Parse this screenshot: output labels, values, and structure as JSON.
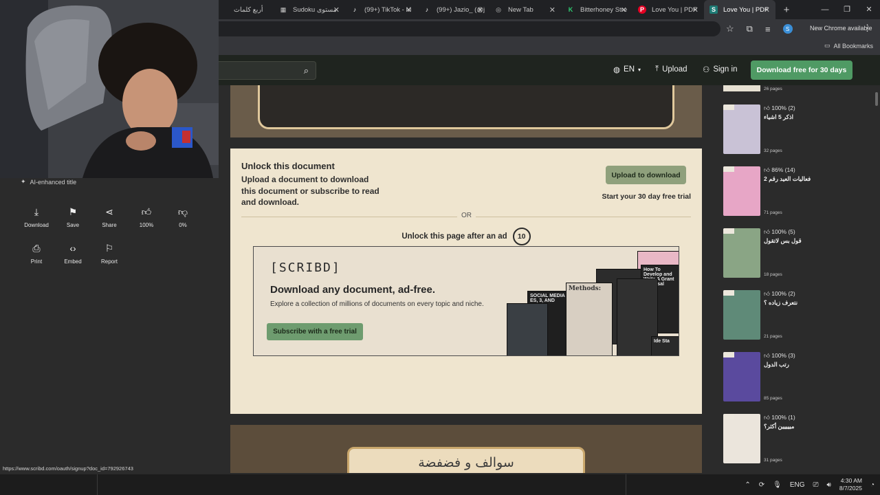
{
  "browser": {
    "tabs": [
      {
        "title": "أربع كلمات",
        "icon": "",
        "color": "#202124"
      },
      {
        "title": "Sudoku مستوى",
        "icon": "▦",
        "color": "#c8c8c8"
      },
      {
        "title": "(99+) TikTok - M",
        "icon": "♪",
        "color": "#ffffff"
      },
      {
        "title": "(99+) Jazio_ (@j",
        "icon": "♪",
        "color": "#ffffff"
      },
      {
        "title": "New Tab",
        "icon": "◎",
        "color": "#c8c8c8"
      },
      {
        "title": "Bitterhoney Stre",
        "icon": "K",
        "color": "#2ecc71"
      },
      {
        "title": "Love You | PDF",
        "icon": "P",
        "color": "#e60023"
      },
      {
        "title": "Love You | PDF",
        "icon": "S",
        "color": "#1e7b75"
      }
    ],
    "new_chrome_label": "New Chrome available",
    "profile_initial": "S",
    "all_bookmarks_label": "All Bookmarks"
  },
  "header": {
    "language": "EN",
    "upload_label": "Upload",
    "signin_label": "Sign in",
    "download_free_label": "Download free for 30 days"
  },
  "left_panel": {
    "ai_title": "AI-enhanced title",
    "actions": [
      {
        "label": "Download",
        "icon": "download-icon"
      },
      {
        "label": "Save",
        "icon": "bookmark-icon"
      },
      {
        "label": "Share",
        "icon": "share-icon"
      },
      {
        "label": "100%",
        "icon": "thumbs-up-icon"
      },
      {
        "label": "0%",
        "icon": "thumbs-down-icon"
      },
      {
        "label": "Print",
        "icon": "print-icon"
      },
      {
        "label": "Embed",
        "icon": "embed-icon"
      },
      {
        "label": "Report",
        "icon": "flag-icon"
      }
    ]
  },
  "unlock": {
    "title": "Unlock this document",
    "description": "Upload a document to download this document or subscribe to read and download.",
    "upload_button": "Upload to download",
    "trial_text": "Start your 30 day free trial",
    "or": "OR",
    "ad_text": "Unlock this page after an ad",
    "countdown": "10"
  },
  "ad": {
    "logo": "[SCRIBD]",
    "headline": "Download any document, ad-free.",
    "sub": "Explore a collection of millions of documents on every topic and niche.",
    "button": "Subscribe with a free trial",
    "book_titles": [
      "How To Develop and Write A Grant Proposal",
      "SOCIAL MEDIA ES, 3, AND",
      "Methods:",
      "Ide Sta"
    ]
  },
  "next_page_title": "سوالف و فضفضة",
  "sidebar": {
    "top_pages": "26 pages",
    "items": [
      {
        "stat": "100% (2)",
        "name": "اذكر 5 اشياء",
        "pages": "32 pages",
        "thumb": "#c9c2d6"
      },
      {
        "stat": "86% (14)",
        "name": "فعاليات العيد رقم 2",
        "pages": "71 pages",
        "thumb": "#e7a6c6"
      },
      {
        "stat": "100% (5)",
        "name": "قول بس لاتقول",
        "pages": "18 pages",
        "thumb": "#8aa585"
      },
      {
        "stat": "100% (2)",
        "name": "نتعرف زياده ؟",
        "pages": "21 pages",
        "thumb": "#5f8a78"
      },
      {
        "stat": "100% (3)",
        "name": "رتب الدول",
        "pages": "85 pages",
        "thumb": "#5a4a9e"
      },
      {
        "stat": "100% (1)",
        "name": "مييييين أكثر؟",
        "pages": "31 pages",
        "thumb": "#ebe5dc"
      }
    ]
  },
  "status_url": "https://www.scribd.com/oauth/signup?doc_id=792926743",
  "taskbar": {
    "lang": "ENG",
    "time": "4:30 AM",
    "date": "8/7/2025"
  }
}
